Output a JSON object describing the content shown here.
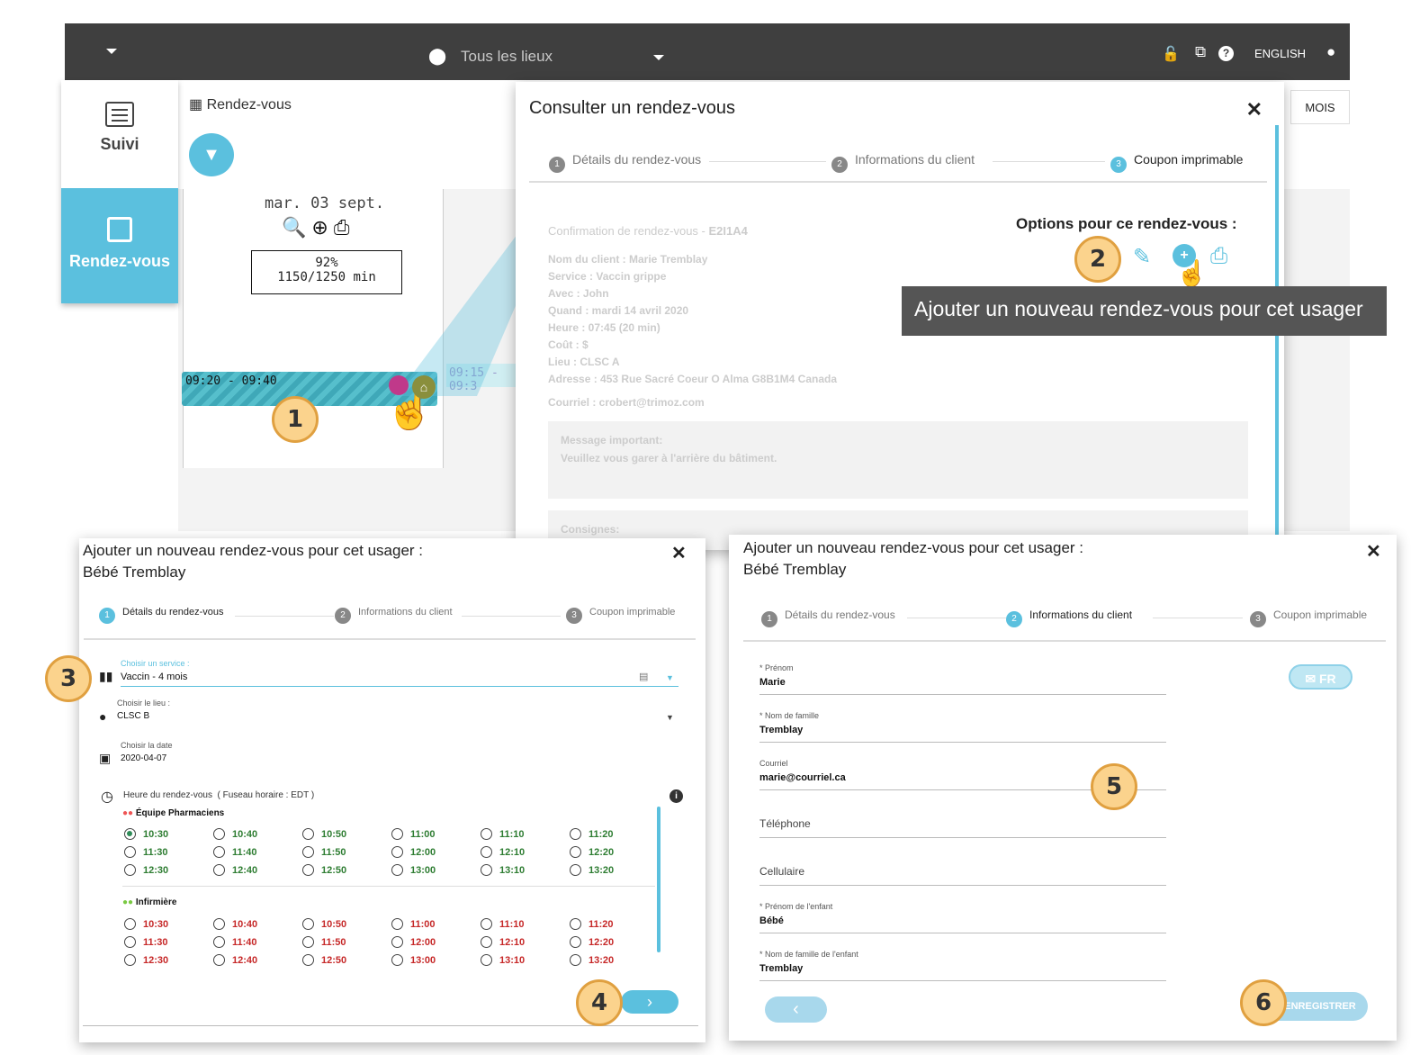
{
  "topbar": {
    "location": "Tous les lieux",
    "language": "ENGLISH"
  },
  "sidebar": {
    "items": [
      {
        "label": "Suivi",
        "icon": "list-icon"
      },
      {
        "label": "Rendez-vous",
        "icon": "calendar-icon"
      }
    ]
  },
  "calendar": {
    "header": "Rendez-vous",
    "view_button": "MOIS",
    "day": {
      "date": "mar. 03 sept.",
      "percent": "92%",
      "minutes": "1150/1250 min"
    },
    "slot": "09:20 - 09:40",
    "slot2": "09:15 - 09:3"
  },
  "consult_modal": {
    "title": "Consulter un rendez-vous",
    "steps": [
      {
        "n": "1",
        "label": "Détails du rendez-vous"
      },
      {
        "n": "2",
        "label": "Informations du client"
      },
      {
        "n": "3",
        "label": "Coupon imprimable"
      }
    ],
    "confirmation": "Confirmation de rendez-vous - ",
    "confirmation_code": "E2I1A4",
    "details": [
      "Nom du client : Marie Tremblay",
      "Service : Vaccin grippe",
      "Avec : John",
      "Quand : mardi 14 avril 2020",
      "Heure : 07:45 (20 min)",
      "Coût : $",
      "Lieu : CLSC A",
      "Adresse : 453 Rue Sacré Coeur O Alma G8B1M4 Canada"
    ],
    "email": "Courriel : crobert@trimoz.com",
    "important_title": "Message important:",
    "important_text": "Veuillez vous garer à l'arrière du bâtiment.",
    "consignes": "Consignes:",
    "options_title": "Options pour ce rendez-vous :",
    "tooltip": "Ajouter un nouveau rendez-vous pour cet usager"
  },
  "badges": [
    "1",
    "2",
    "3",
    "4",
    "5",
    "6"
  ],
  "add_modal": {
    "title_line1": "Ajouter un nouveau rendez-vous pour cet usager :",
    "title_line2": "Bébé Tremblay",
    "steps": [
      {
        "n": "1",
        "label": "Détails du rendez-vous"
      },
      {
        "n": "2",
        "label": "Informations du client"
      },
      {
        "n": "3",
        "label": "Coupon imprimable"
      }
    ],
    "service_label": "Choisir un service :",
    "service_value": "Vaccin - 4 mois",
    "lieu_label": "Choisir le lieu :",
    "lieu_value": "CLSC B",
    "date_label": "Choisir la date",
    "date_value": "2020-04-07",
    "heure_label": "Heure du rendez-vous",
    "timezone": "( Fuseau horaire : EDT )",
    "teams": [
      {
        "name": "Équipe Pharmaciens",
        "status": "available",
        "times": [
          "10:30",
          "10:40",
          "10:50",
          "11:00",
          "11:10",
          "11:20",
          "11:30",
          "11:40",
          "11:50",
          "12:00",
          "12:10",
          "12:20",
          "12:30",
          "12:40",
          "12:50",
          "13:00",
          "13:10",
          "13:20"
        ]
      },
      {
        "name": "Infirmière",
        "status": "unavailable",
        "times": [
          "10:30",
          "10:40",
          "10:50",
          "11:00",
          "11:10",
          "11:20",
          "11:30",
          "11:40",
          "11:50",
          "12:00",
          "12:10",
          "12:20",
          "12:30",
          "12:40",
          "12:50",
          "13:00",
          "13:10",
          "13:20"
        ]
      }
    ],
    "selected_time": "10:30",
    "next_glyph": "›"
  },
  "client_modal": {
    "title_line1": "Ajouter un nouveau rendez-vous pour cet usager :",
    "title_line2": "Bébé Tremblay",
    "lang_button": "FR",
    "fields": [
      {
        "label": "* Prénom",
        "value": "Marie"
      },
      {
        "label": "* Nom de famille",
        "value": "Tremblay"
      },
      {
        "label": "Courriel",
        "value": "marie@courriel.ca"
      },
      {
        "label": "",
        "placeholder": "Téléphone",
        "value": ""
      },
      {
        "label": "",
        "placeholder": "Cellulaire",
        "value": ""
      },
      {
        "label": "* Prénom de l'enfant",
        "value": "Bébé"
      },
      {
        "label": "* Nom de famille de l'enfant",
        "value": "Tremblay"
      }
    ],
    "back_glyph": "‹",
    "save_button": "ENREGISTRER"
  },
  "colors": {
    "accent": "#5bc0de",
    "topbar": "#3f3f3f",
    "available": "#2e7d32",
    "unavailable": "#c62828",
    "badge": "#fbd38d"
  }
}
